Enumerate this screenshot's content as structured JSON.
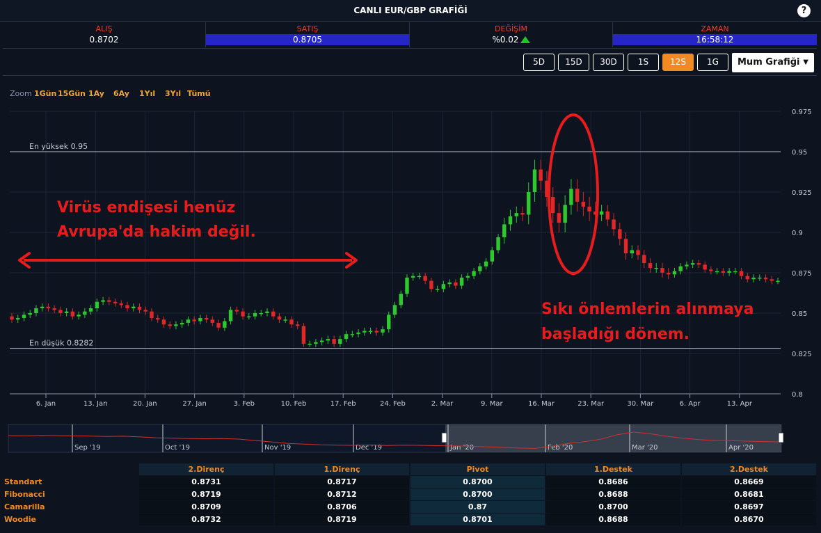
{
  "window": {
    "title": "CANLI EUR/GBP GRAFİĞİ",
    "help_label": "?"
  },
  "quotes": {
    "alis": {
      "label": "ALIŞ",
      "value": "0.8702"
    },
    "satis": {
      "label": "SATIŞ",
      "value": "0.8705"
    },
    "degisim": {
      "label": "DEĞİŞİM",
      "value": "%0.02"
    },
    "zaman": {
      "label": "ZAMAN",
      "value": "16:58:12"
    }
  },
  "toolbar": {
    "ranges": [
      "5D",
      "15D",
      "30D",
      "1S",
      "12S",
      "1G"
    ],
    "active_range": "12S",
    "chart_type": "Mum Grafiği"
  },
  "zoom": {
    "label": "Zoom",
    "options": [
      "1Gün",
      "15Gün",
      "1Ay",
      "6Ay",
      "1Yıl",
      "3Yıl",
      "Tümü"
    ]
  },
  "colors": {
    "up": "#2ec92e",
    "down": "#e02828",
    "accent": "#f28a24",
    "annotation": "#e81c1c"
  },
  "annotations": {
    "left_text_1": "Virüs endişesi henüz",
    "left_text_2": "Avrupa'da hakim değil.",
    "right_text_1": "Sıkı önlemlerin alınmaya",
    "right_text_2": "başladığı dönem."
  },
  "chart_data": {
    "type": "candlestick",
    "title": "CANLI EUR/GBP GRAFİĞİ",
    "ylim": [
      0.8,
      0.975
    ],
    "y_ticks": [
      "0.975",
      "0.95",
      "0.925",
      "0.9",
      "0.875",
      "0.85",
      "0.825",
      "0.8"
    ],
    "x_ticks": [
      "6. Jan",
      "13. Jan",
      "20. Jan",
      "27. Jan",
      "3. Feb",
      "10. Feb",
      "17. Feb",
      "24. Feb",
      "2. Mar",
      "9. Mar",
      "16. Mar",
      "23. Mar",
      "30. Mar",
      "6. Apr",
      "13. Apr"
    ],
    "high_label": "En yüksek 0.95",
    "high_value": 0.95,
    "low_label": "En düşük 0.8282",
    "low_value": 0.8282,
    "close": [
      0.846,
      0.847,
      0.849,
      0.85,
      0.853,
      0.854,
      0.853,
      0.852,
      0.85,
      0.851,
      0.848,
      0.849,
      0.851,
      0.853,
      0.857,
      0.858,
      0.857,
      0.856,
      0.855,
      0.853,
      0.854,
      0.852,
      0.851,
      0.847,
      0.846,
      0.843,
      0.842,
      0.843,
      0.844,
      0.846,
      0.845,
      0.847,
      0.846,
      0.844,
      0.841,
      0.845,
      0.852,
      0.851,
      0.848,
      0.848,
      0.85,
      0.85,
      0.851,
      0.848,
      0.846,
      0.846,
      0.843,
      0.842,
      0.831,
      0.831,
      0.832,
      0.833,
      0.834,
      0.831,
      0.834,
      0.837,
      0.837,
      0.838,
      0.839,
      0.839,
      0.838,
      0.84,
      0.849,
      0.855,
      0.862,
      0.872,
      0.873,
      0.873,
      0.87,
      0.865,
      0.865,
      0.868,
      0.869,
      0.867,
      0.872,
      0.873,
      0.876,
      0.879,
      0.882,
      0.889,
      0.897,
      0.905,
      0.91,
      0.912,
      0.911,
      0.925,
      0.939,
      0.932,
      0.922,
      0.912,
      0.906,
      0.917,
      0.927,
      0.919,
      0.916,
      0.913,
      0.911,
      0.913,
      0.908,
      0.902,
      0.896,
      0.887,
      0.889,
      0.886,
      0.881,
      0.878,
      0.878,
      0.875,
      0.874,
      0.876,
      0.879,
      0.88,
      0.881,
      0.88,
      0.877,
      0.876,
      0.876,
      0.875,
      0.876,
      0.876,
      0.873,
      0.871,
      0.872,
      0.872,
      0.871,
      0.87,
      0.87
    ],
    "volatility": [
      0.002,
      0.002,
      0.002,
      0.002,
      0.002,
      0.002,
      0.002,
      0.002,
      0.002,
      0.002,
      0.002,
      0.002,
      0.002,
      0.002,
      0.002,
      0.002,
      0.002,
      0.002,
      0.002,
      0.002,
      0.002,
      0.002,
      0.002,
      0.002,
      0.002,
      0.002,
      0.002,
      0.002,
      0.002,
      0.002,
      0.002,
      0.002,
      0.002,
      0.002,
      0.002,
      0.002,
      0.002,
      0.002,
      0.002,
      0.002,
      0.002,
      0.002,
      0.002,
      0.002,
      0.002,
      0.002,
      0.002,
      0.002,
      0.002,
      0.002,
      0.002,
      0.002,
      0.002,
      0.002,
      0.002,
      0.002,
      0.002,
      0.002,
      0.002,
      0.002,
      0.002,
      0.002,
      0.002,
      0.002,
      0.002,
      0.002,
      0.002,
      0.002,
      0.002,
      0.002,
      0.002,
      0.002,
      0.002,
      0.002,
      0.002,
      0.002,
      0.002,
      0.002,
      0.002,
      0.002,
      0.002,
      0.004,
      0.004,
      0.004,
      0.004,
      0.006,
      0.006,
      0.006,
      0.006,
      0.006,
      0.006,
      0.006,
      0.006,
      0.006,
      0.006,
      0.006,
      0.006,
      0.004,
      0.004,
      0.004,
      0.004,
      0.004,
      0.003,
      0.003,
      0.003,
      0.003,
      0.003,
      0.003,
      0.003,
      0.002,
      0.002,
      0.002,
      0.002,
      0.002,
      0.002,
      0.002,
      0.002,
      0.002,
      0.002,
      0.002,
      0.002,
      0.002,
      0.002,
      0.002,
      0.002,
      0.002,
      0.002
    ]
  },
  "navigator": {
    "labels": [
      "Sep '19",
      "Oct '19",
      "Nov '19",
      "Dec '19",
      "Jan '20",
      "Feb '20",
      "Mar '20",
      "Apr '20"
    ],
    "series": [
      0.905,
      0.904,
      0.906,
      0.905,
      0.904,
      0.903,
      0.901,
      0.902,
      0.898,
      0.893,
      0.891,
      0.889,
      0.888,
      0.889,
      0.886,
      0.878,
      0.87,
      0.862,
      0.858,
      0.854,
      0.852,
      0.851,
      0.853,
      0.85,
      0.852,
      0.851,
      0.849,
      0.848,
      0.846,
      0.843,
      0.84,
      0.836,
      0.834,
      0.844,
      0.862,
      0.871,
      0.885,
      0.91,
      0.925,
      0.916,
      0.902,
      0.891,
      0.883,
      0.878,
      0.877,
      0.874,
      0.872,
      0.87
    ],
    "selection_start": "Jan '20"
  },
  "pivot": {
    "headers": [
      "2.Direnç",
      "1.Direnç",
      "Pivot",
      "1.Destek",
      "2.Destek"
    ],
    "rows": [
      {
        "name": "Standart",
        "values": [
          "0.8731",
          "0.8717",
          "0.8700",
          "0.8686",
          "0.8669"
        ]
      },
      {
        "name": "Fibonacci",
        "values": [
          "0.8719",
          "0.8712",
          "0.8700",
          "0.8688",
          "0.8681"
        ]
      },
      {
        "name": "Camarilla",
        "values": [
          "0.8709",
          "0.8706",
          "0.87",
          "0.8700",
          "0.8697"
        ]
      },
      {
        "name": "Woodie",
        "values": [
          "0.8732",
          "0.8719",
          "0.8701",
          "0.8688",
          "0.8670"
        ]
      }
    ]
  }
}
